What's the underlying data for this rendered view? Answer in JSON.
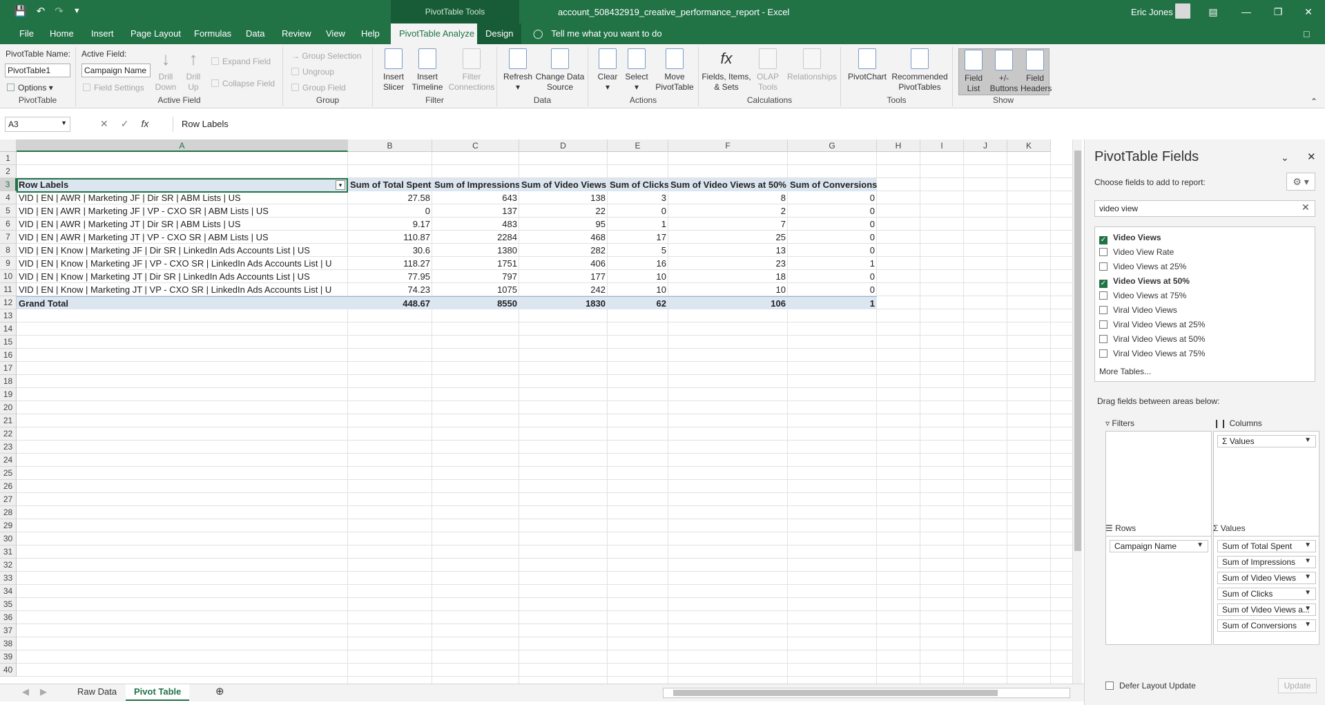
{
  "titlebar": {
    "context_tools": "PivotTable Tools",
    "document_title": "account_508432919_creative_performance_report  -  Excel",
    "user_name": "Eric Jones"
  },
  "menu_tabs": [
    {
      "label": "File"
    },
    {
      "label": "Home"
    },
    {
      "label": "Insert"
    },
    {
      "label": "Page Layout"
    },
    {
      "label": "Formulas"
    },
    {
      "label": "Data"
    },
    {
      "label": "Review"
    },
    {
      "label": "View"
    },
    {
      "label": "Help"
    },
    {
      "label": "PivotTable Analyze"
    },
    {
      "label": "Design"
    },
    {
      "label": "Tell me what you want to do"
    }
  ],
  "ribbon": {
    "pivottable": {
      "name_label": "PivotTable Name:",
      "name_value": "PivotTable1",
      "options_label": "Options",
      "group_label": "PivotTable"
    },
    "active_field": {
      "label": "Active Field:",
      "value": "Campaign Name",
      "field_settings": "Field Settings",
      "drill_down": "Drill\nDown",
      "drill_up": "Drill\nUp",
      "expand_field": "Expand Field",
      "collapse_field": "Collapse Field",
      "group_label": "Active Field"
    },
    "group": {
      "group_selection": "Group Selection",
      "ungroup": "Ungroup",
      "group_field": "Group Field",
      "group_label": "Group"
    },
    "filter": {
      "insert_slicer": "Insert\nSlicer",
      "insert_timeline": "Insert\nTimeline",
      "filter_connections": "Filter\nConnections",
      "group_label": "Filter"
    },
    "data": {
      "refresh": "Refresh",
      "change_source": "Change Data\nSource",
      "group_label": "Data"
    },
    "actions": {
      "clear": "Clear",
      "select": "Select",
      "move": "Move\nPivotTable",
      "group_label": "Actions"
    },
    "calculations": {
      "fields_items": "Fields, Items,\n& Sets",
      "olap_tools": "OLAP\nTools",
      "relationships": "Relationships",
      "group_label": "Calculations"
    },
    "tools": {
      "pivotchart": "PivotChart",
      "recommended": "Recommended\nPivotTables",
      "group_label": "Tools"
    },
    "show": {
      "field_list": "Field\nList",
      "buttons": "+/-\nButtons",
      "field_headers": "Field\nHeaders",
      "group_label": "Show"
    }
  },
  "formula_bar": {
    "name_box": "A3",
    "content": "Row Labels"
  },
  "grid": {
    "columns": [
      "A",
      "B",
      "C",
      "D",
      "E",
      "F",
      "G",
      "H",
      "I",
      "J",
      "K"
    ],
    "row_numbers": [
      "1",
      "2",
      "3",
      "4",
      "5",
      "6",
      "7",
      "8",
      "9",
      "10",
      "11",
      "12",
      "13",
      "14",
      "15",
      "16",
      "17",
      "18",
      "19",
      "20",
      "21",
      "22",
      "23",
      "24",
      "25",
      "26",
      "27",
      "28",
      "29",
      "30",
      "31",
      "32",
      "33",
      "34",
      "35",
      "36",
      "37",
      "38",
      "39",
      "40"
    ],
    "headers": [
      "Row Labels",
      "Sum of Total Spent",
      "Sum of Impressions",
      "Sum of Video Views",
      "Sum of Clicks",
      "Sum of Video Views at 50%",
      "Sum of Conversions"
    ],
    "rows": [
      [
        "VID | EN | AWR | Marketing JF | Dir SR | ABM Lists | US",
        "27.58",
        "643",
        "138",
        "3",
        "8",
        "0"
      ],
      [
        "VID | EN | AWR | Marketing JF | VP - CXO SR | ABM Lists | US",
        "0",
        "137",
        "22",
        "0",
        "2",
        "0"
      ],
      [
        "VID | EN | AWR | Marketing JT | Dir SR | ABM Lists | US",
        "9.17",
        "483",
        "95",
        "1",
        "7",
        "0"
      ],
      [
        "VID | EN | AWR | Marketing JT | VP - CXO SR | ABM Lists | US",
        "110.87",
        "2284",
        "468",
        "17",
        "25",
        "0"
      ],
      [
        "VID | EN | Know | Marketing JF | Dir SR | LinkedIn Ads Accounts List | US",
        "30.6",
        "1380",
        "282",
        "5",
        "13",
        "0"
      ],
      [
        "VID | EN | Know | Marketing JF | VP - CXO SR | LinkedIn Ads Accounts List | U",
        "118.27",
        "1751",
        "406",
        "16",
        "23",
        "1"
      ],
      [
        "VID | EN | Know | Marketing JT | Dir SR | LinkedIn Ads Accounts List | US",
        "77.95",
        "797",
        "177",
        "10",
        "18",
        "0"
      ],
      [
        "VID | EN | Know | Marketing JT | VP - CXO SR | LinkedIn Ads Accounts List | U",
        "74.23",
        "1075",
        "242",
        "10",
        "10",
        "0"
      ]
    ],
    "total": [
      "Grand Total",
      "448.67",
      "8550",
      "1830",
      "62",
      "106",
      "1"
    ]
  },
  "sheets": [
    {
      "name": "Raw Data",
      "active": false
    },
    {
      "name": "Pivot Table",
      "active": true
    }
  ],
  "field_pane": {
    "title": "PivotTable Fields",
    "subtitle": "Choose fields to add to report:",
    "search_value": "video view",
    "fields": [
      {
        "label": "Video Views",
        "checked": true
      },
      {
        "label": "Video View Rate",
        "checked": false
      },
      {
        "label": "Video Views at 25%",
        "checked": false
      },
      {
        "label": "Video Views at 50%",
        "checked": true
      },
      {
        "label": "Video Views at 75%",
        "checked": false
      },
      {
        "label": "Viral Video Views",
        "checked": false
      },
      {
        "label": "Viral Video Views at 25%",
        "checked": false
      },
      {
        "label": "Viral Video Views at 50%",
        "checked": false
      },
      {
        "label": "Viral Video Views at 75%",
        "checked": false
      }
    ],
    "more_tables": "More Tables...",
    "drag_text": "Drag fields between areas below:",
    "filters_label": "Filters",
    "columns_label": "Columns",
    "rows_label": "Rows",
    "values_label": "Values",
    "columns_items": [
      "Values"
    ],
    "rows_items": [
      "Campaign Name"
    ],
    "values_items": [
      "Sum of Total Spent",
      "Sum of Impressions",
      "Sum of Video Views",
      "Sum of Clicks",
      "Sum of Video Views a...",
      "Sum of Conversions"
    ],
    "defer_label": "Defer Layout Update",
    "update_label": "Update"
  },
  "colors": {
    "excel_green": "#217346",
    "pivot_header_fill": "#dce6f1"
  }
}
